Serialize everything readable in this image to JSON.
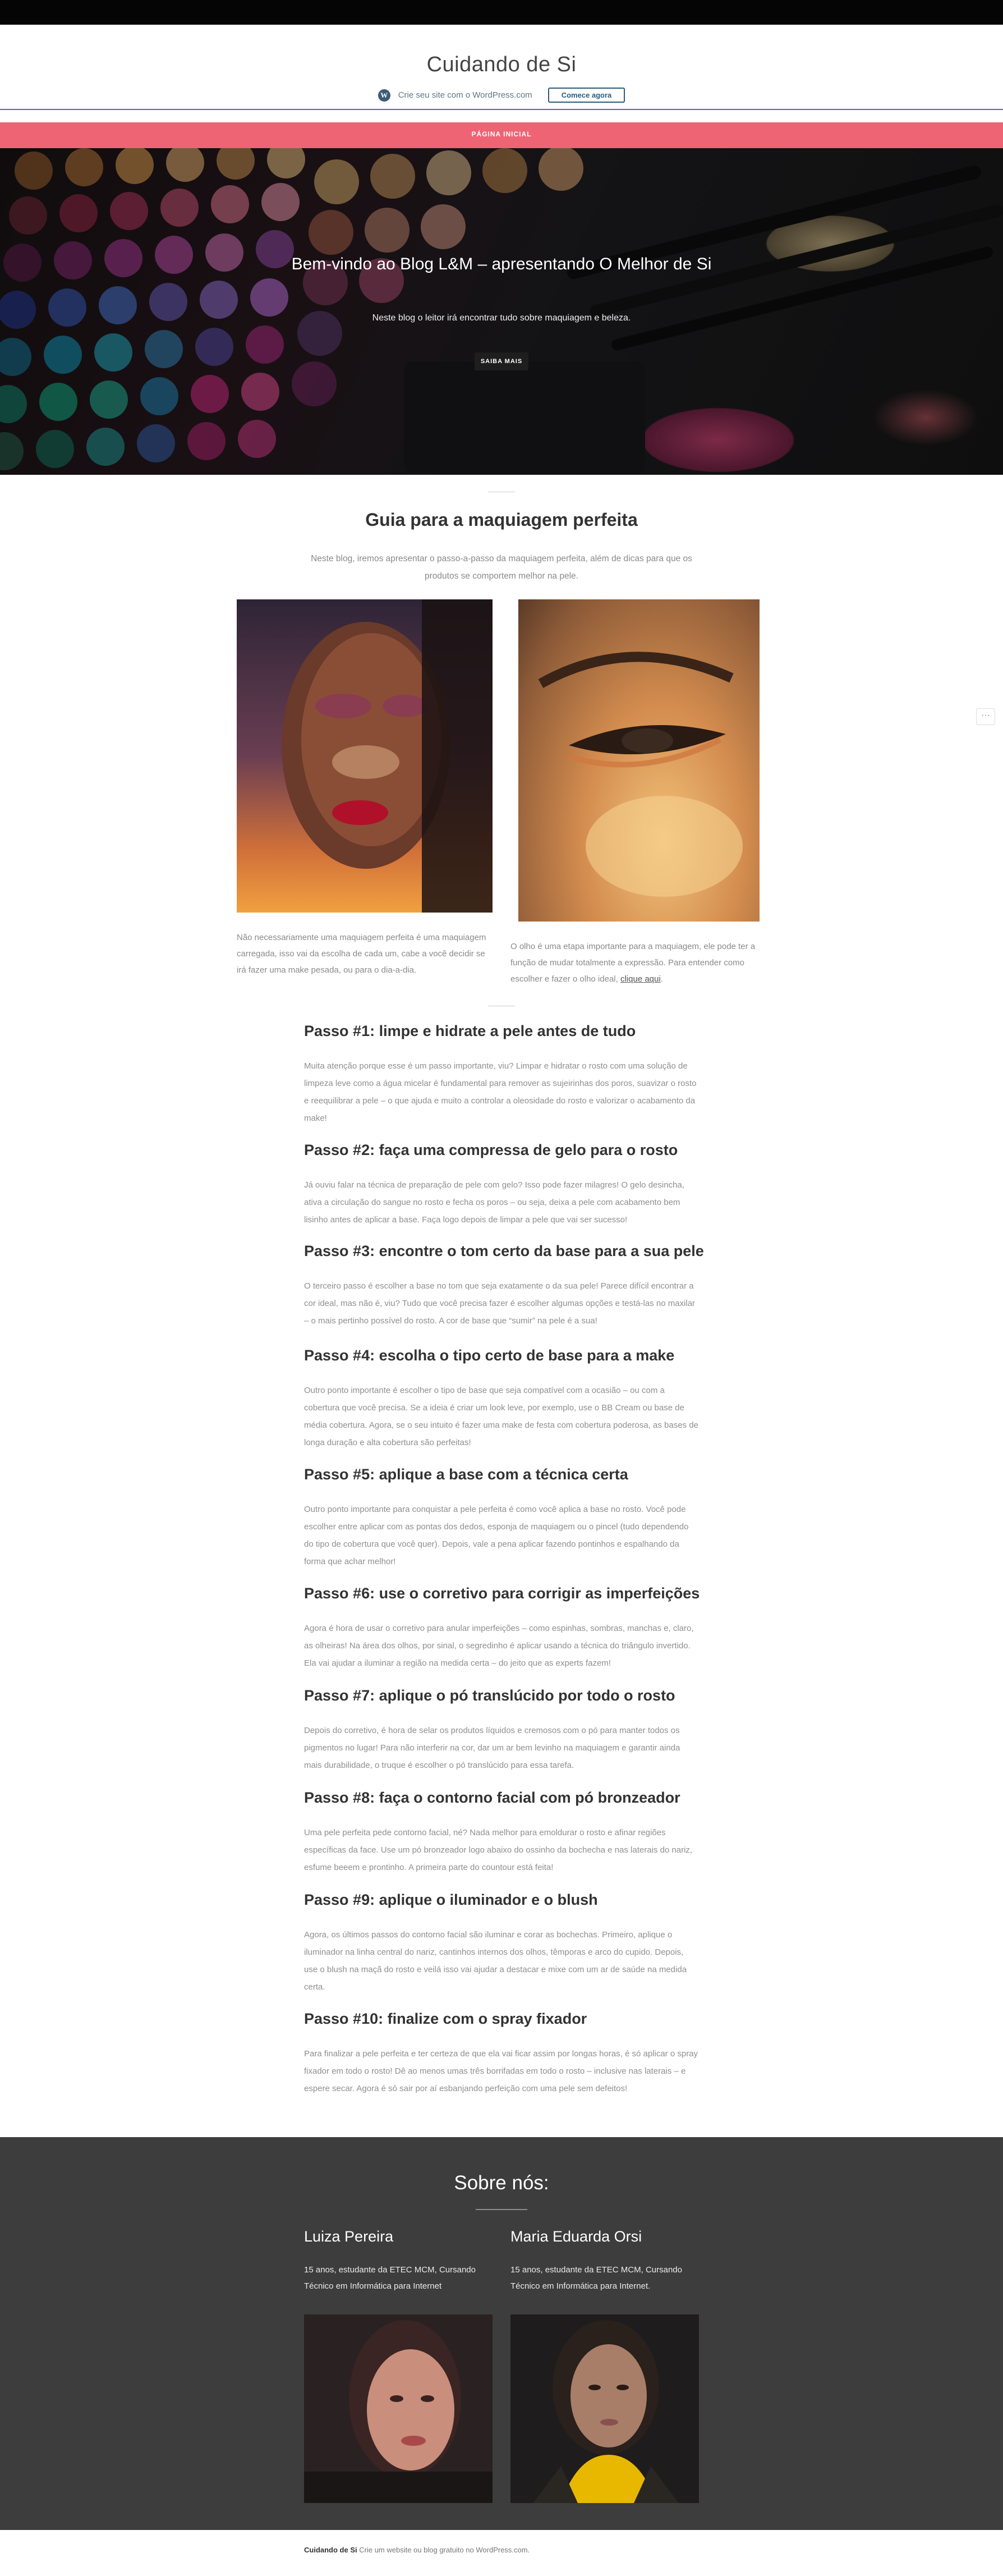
{
  "site": {
    "title": "Cuidando de Si"
  },
  "wpbar": {
    "logo": "W",
    "text": "Crie seu site com o WordPress.com",
    "cta": "Comece agora"
  },
  "nav": {
    "items": [
      "PÁGINA INICIAL"
    ]
  },
  "hero": {
    "title": "Bem-vindo ao Blog L&M – apresentando O Melhor de Si",
    "subtitle": "Neste blog o leitor irá encontrar tudo sobre maquiagem e beleza.",
    "button": "SAIBA MAIS"
  },
  "guide": {
    "title": "Guia para a maquiagem perfeita",
    "intro": "Neste blog, iremos apresentar o passo-a-passo da maquiagem perfeita, além de dicas para que os produtos se comportem melhor na pele.",
    "caption_left": "Não necessariamente uma maquiagem perfeita é uma maquiagem carregada, isso vai da escolha de cada um, cabe a você decidir se irá fazer uma make pesada, ou para o dia-a-dia.",
    "caption_right_text": "O olho é uma etapa importante para a maquiagem, ele pode ter a função de mudar totalmente a expressão. Para entender como escolher e fazer o olho ideal,",
    "caption_right_link": "clique aqui",
    "caption_right_end": "."
  },
  "steps": [
    {
      "title": "Passo #1: limpe e hidrate a pele antes de tudo",
      "text": "Muita atenção porque esse é um passo importante, viu? Limpar e hidratar o rosto com uma solução de limpeza leve como a água micelar é fundamental para remover as sujeirinhas dos poros, suavizar o rosto e reequilibrar a pele – o que ajuda e muito a controlar a oleosidade do rosto e valorizar o acabamento da make!"
    },
    {
      "title": "Passo #2: faça uma compressa de gelo para o rosto",
      "text": "Já ouviu falar na técnica de preparação de pele com gelo? Isso pode fazer milagres! O gelo desincha, ativa a circulação do sangue no rosto e fecha os poros – ou seja, deixa a pele com acabamento bem lisinho antes de aplicar a base. Faça logo depois de limpar a pele que vai ser sucesso!"
    },
    {
      "title": "Passo #3: encontre o tom certo da base para a sua pele",
      "text": "O terceiro passo é escolher a base no tom que seja exatamente o da sua pele! Parece difícil encontrar a cor ideal, mas não é, viu? Tudo que você precisa fazer é escolher algumas opções e testá-las no maxilar – o mais pertinho possível do rosto. A cor de base que “sumir” na pele é a sua!"
    },
    {
      "title": "Passo #4: escolha o tipo certo de base para a make",
      "text": "Outro ponto importante é escolher o tipo de base que seja compatível com a ocasião – ou com a cobertura que você precisa. Se a ideia é criar um look leve, por exemplo, use o BB Cream ou base de média cobertura. Agora, se o seu intuito é fazer uma make de festa com cobertura poderosa, as bases de longa duração e alta cobertura são perfeitas!"
    },
    {
      "title": "Passo #5: aplique a base com a técnica certa",
      "text": "Outro ponto importante para conquistar a pele perfeita é como você aplica a base no rosto. Você pode escolher entre aplicar com as pontas dos dedos, esponja de maquiagem ou o pincel (tudo dependendo do tipo de cobertura que você quer). Depois, vale a pena aplicar fazendo pontinhos e espalhando da forma que achar melhor!"
    },
    {
      "title": "Passo #6: use o corretivo para corrigir as imperfeições",
      "text": "Agora é hora de usar o corretivo para anular imperfeições – como espinhas, sombras, manchas e, claro, as olheiras! Na área dos olhos, por sinal, o segredinho é aplicar usando a técnica do triângulo invertido. Ela vai ajudar a iluminar a região na medida certa – do jeito que as experts fazem!"
    },
    {
      "title": "Passo #7: aplique o pó translúcido por todo o rosto",
      "text": "Depois do corretivo, é hora de selar os produtos líquidos e cremosos com o pó para manter todos os pigmentos no lugar! Para não interferir na cor, dar um ar bem levinho na maquiagem e garantir ainda mais durabilidade, o truque é escolher o pó translúcido para essa tarefa."
    },
    {
      "title": "Passo #8: faça o contorno facial com pó bronzeador",
      "text": "Uma pele perfeita pede contorno facial, né? Nada melhor para emoldurar o rosto e afinar regiões específicas da face. Use um pó bronzeador logo abaixo do ossinho da bochecha e nas laterais do nariz, esfume beeem e prontinho. A primeira parte do countour está feita!"
    },
    {
      "title": "Passo #9: aplique o iluminador e o blush",
      "text": "Agora, os últimos passos do contorno facial são iluminar e corar as bochechas. Primeiro, aplique o iluminador na linha central do nariz, cantinhos internos dos olhos, têmporas e arco do cupido. Depois, use o blush na maçã do rosto e veilá isso vai ajudar a destacar e mixe com um ar de saúde na medida certa."
    },
    {
      "title": "Passo #10: finalize com o spray fixador",
      "text": "Para finalizar a pele perfeita e ter certeza de que ela vai ficar assim por longas horas, é só aplicar o spray fixador em todo o rosto! Dê ao menos umas três borrifadas em todo o rosto – inclusive nas laterais – e espere secar. Agora é só sair por aí esbanjando perfeição com uma pele sem defeitos!"
    }
  ],
  "about": {
    "title": "Sobre nós:",
    "people": [
      {
        "name": "Luiza Pereira",
        "bio": "15 anos, estudante da ETEC MCM, Cursando Técnico em Informática para Internet"
      },
      {
        "name": "Maria Eduarda Orsi",
        "bio": "15 anos, estudante da ETEC MCM, Cursando Técnico em Informática para Internet."
      }
    ]
  },
  "footer": {
    "site_name": "Cuidando de Si",
    "text": "Crie um website ou blog gratuito no WordPress.com."
  },
  "widget": {
    "label": "···"
  },
  "colors": {
    "nav": "#ee6475",
    "dark_footer": "#3d3d3d",
    "wp_blue": "#2d5b79"
  }
}
